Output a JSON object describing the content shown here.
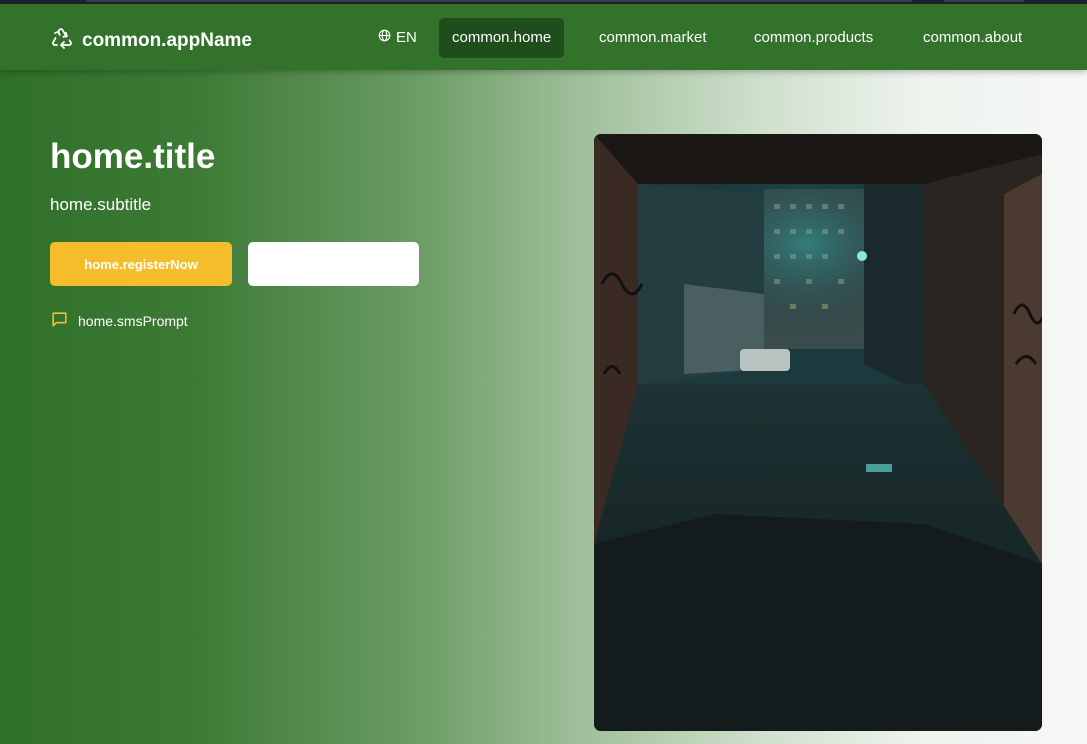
{
  "header": {
    "app_name": "common.appName",
    "logo_icon": "recycle-icon",
    "language": {
      "label": "EN",
      "icon": "globe-icon"
    },
    "nav": [
      {
        "label": "common.home",
        "active": true
      },
      {
        "label": "common.market",
        "active": false
      },
      {
        "label": "common.products",
        "active": false
      },
      {
        "label": "common.about",
        "active": false
      }
    ]
  },
  "hero": {
    "title": "home.title",
    "subtitle": "home.subtitle",
    "register_label": "home.registerNow",
    "secondary_label": "",
    "sms_prompt": "home.smsPrompt",
    "sms_icon": "message-icon"
  },
  "colors": {
    "header_bg": "#33722b",
    "nav_active_bg": "#1f4d1b",
    "accent": "#f5bd2b"
  }
}
